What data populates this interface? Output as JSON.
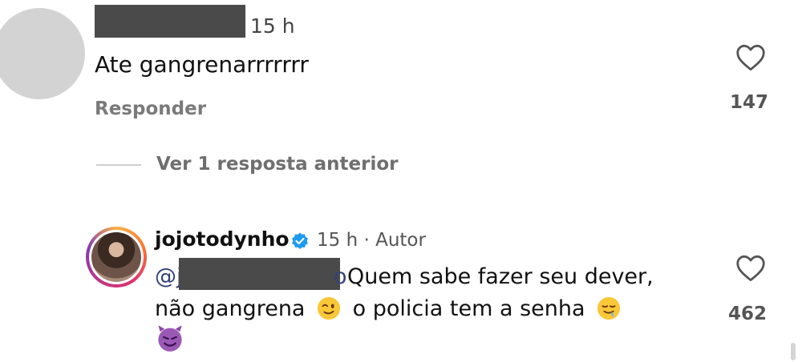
{
  "comments": [
    {
      "time": "15 h",
      "text": "Ate gangrenarrrrrrr",
      "reply_label": "Responder",
      "likes": "147"
    },
    {
      "username": "jojotodynho",
      "meta": "15 h · Autor",
      "mention_prefix": "@j",
      "mention_suffix": "o",
      "text_line1": "Quem sabe fazer seu dever,",
      "text_line2a": "não gangrena",
      "text_line2b": "o policia tem a senha",
      "likes": "462"
    }
  ],
  "view_replies_label": "Ver 1 resposta anterior",
  "colors": {
    "redaction": "#4a4a4a",
    "verified_blue": "#1d9bf0",
    "mention_blue": "#33427a"
  },
  "icons": [
    "heart-icon",
    "verified-icon",
    "winking-face-emoji",
    "drooling-face-emoji",
    "smiling-devil-emoji"
  ]
}
